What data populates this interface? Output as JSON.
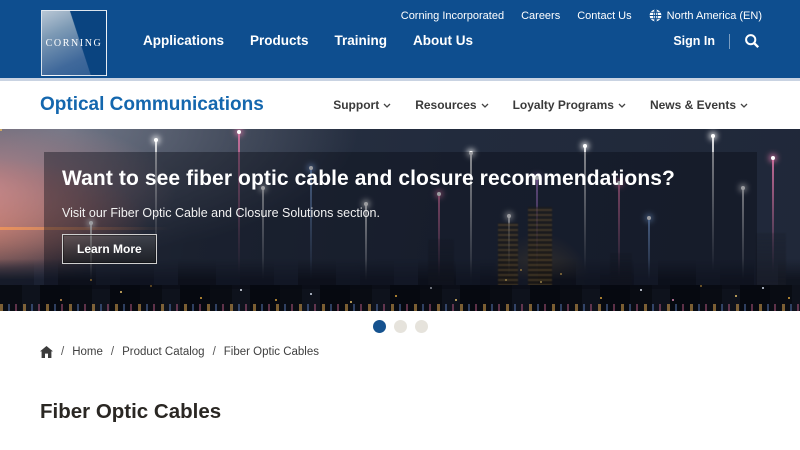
{
  "brand": {
    "logo_text": "CORNING"
  },
  "utility_nav": {
    "items": [
      {
        "label": "Corning Incorporated"
      },
      {
        "label": "Careers"
      },
      {
        "label": "Contact Us"
      }
    ],
    "locale": {
      "label": "North America (EN)"
    }
  },
  "main_nav": {
    "items": [
      {
        "label": "Applications"
      },
      {
        "label": "Products"
      },
      {
        "label": "Training"
      },
      {
        "label": "About Us"
      }
    ],
    "sign_in_label": "Sign In"
  },
  "subnav": {
    "title": "Optical Communications",
    "items": [
      {
        "label": "Support"
      },
      {
        "label": "Resources"
      },
      {
        "label": "Loyalty Programs"
      },
      {
        "label": "News & Events"
      }
    ]
  },
  "hero": {
    "heading": "Want to see fiber optic cable and closure recommendations?",
    "subheading": "Visit our Fiber Optic Cable and Closure Solutions section.",
    "cta_label": "Learn More",
    "carousel": {
      "count": 3,
      "active_index": 0
    }
  },
  "breadcrumb": {
    "separator": "/",
    "items": [
      {
        "label": "Home"
      },
      {
        "label": "Product Catalog"
      },
      {
        "label": "Fiber Optic Cables"
      }
    ]
  },
  "page": {
    "title": "Fiber Optic Cables"
  },
  "colors": {
    "header_blue": "#0e4e8f",
    "link_blue": "#1467ae",
    "active_dot": "#15528f",
    "inactive_dot": "#e6e3dc"
  }
}
